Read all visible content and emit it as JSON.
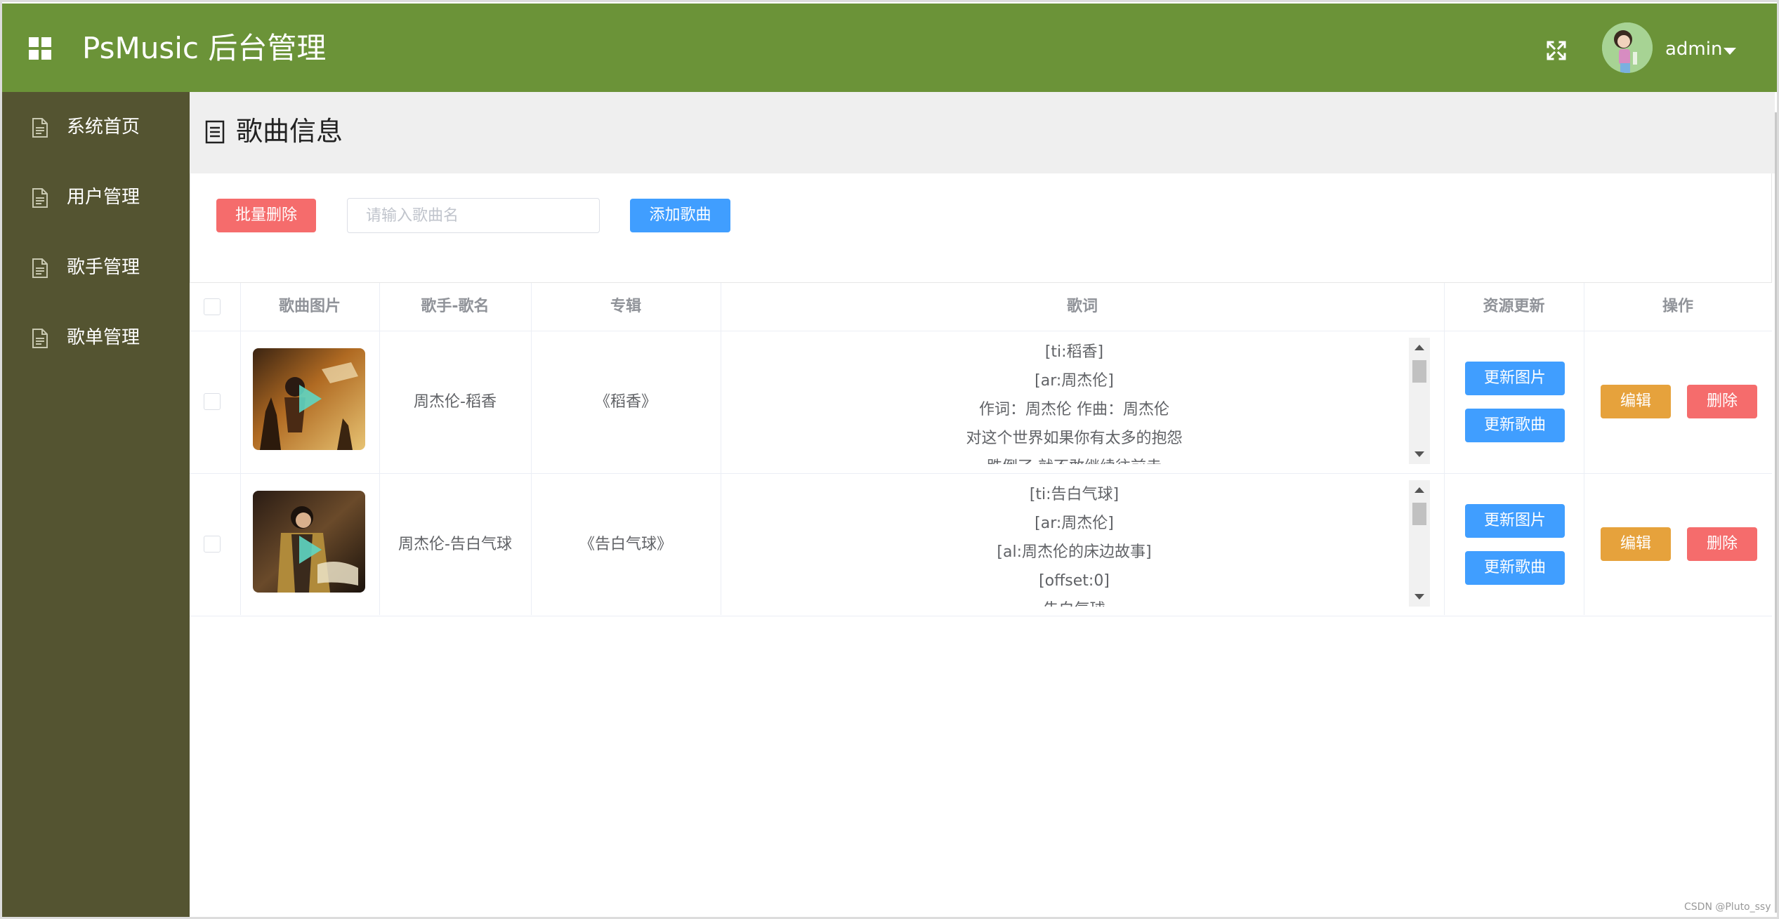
{
  "header": {
    "app_title": "PsMusic 后台管理",
    "user_name": "admin",
    "icons": {
      "menu": "grid-icon",
      "fullscreen": "fullscreen-icon",
      "user_menu": "caret-down-icon"
    },
    "color": "#6b9338"
  },
  "sidebar": {
    "color": "#545431",
    "items": [
      {
        "label": "系统首页",
        "icon": "document-icon"
      },
      {
        "label": "用户管理",
        "icon": "document-icon"
      },
      {
        "label": "歌手管理",
        "icon": "document-icon"
      },
      {
        "label": "歌单管理",
        "icon": "document-icon"
      }
    ]
  },
  "main": {
    "page_title": "歌曲信息",
    "toolbar": {
      "batch_delete_label": "批量删除",
      "search_placeholder": "请输入歌曲名",
      "search_value": "",
      "add_song_label": "添加歌曲"
    },
    "table": {
      "headers": [
        "歌曲图片",
        "歌手-歌名",
        "专辑",
        "歌词",
        "资源更新",
        "操作"
      ],
      "rows": [
        {
          "singer_song": "周杰伦-稻香",
          "album": "《稻香》",
          "lyrics": [
            "[ti:稻香]",
            "[ar:周杰伦]",
            "作词：周杰伦 作曲：周杰伦",
            "对这个世界如果你有太多的抱怨",
            "跌倒了 就不敢继续往前走"
          ],
          "update_image_label": "更新图片",
          "update_song_label": "更新歌曲",
          "edit_label": "编辑",
          "delete_label": "删除"
        },
        {
          "singer_song": "周杰伦-告白气球",
          "album": "《告白气球》",
          "lyrics": [
            "[ti:告白气球]",
            "[ar:周杰伦]",
            "[al:周杰伦的床边故事]",
            "[offset:0]",
            "告白气球"
          ],
          "update_image_label": "更新图片",
          "update_song_label": "更新歌曲",
          "edit_label": "编辑",
          "delete_label": "删除"
        }
      ]
    },
    "colors": {
      "danger": "#f56c6c",
      "primary": "#409eff",
      "warning": "#e6a23c"
    }
  },
  "watermark": "CSDN @Pluto_ssy"
}
